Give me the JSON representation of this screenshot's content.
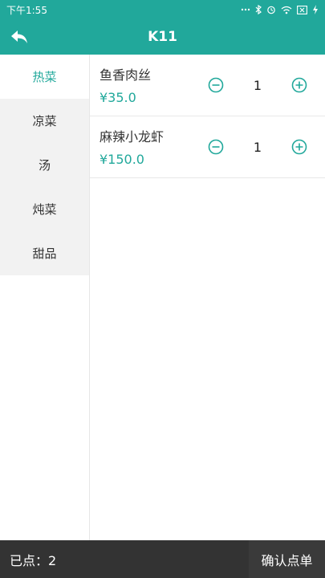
{
  "status_bar": {
    "time": "下午1:55",
    "icons": [
      "dots-icon",
      "bluetooth-icon",
      "alarm-icon",
      "wifi-icon",
      "sim-x-icon",
      "battery-charging-icon"
    ]
  },
  "header": {
    "title": "K11",
    "back_icon": "back-arrow-icon"
  },
  "sidebar": {
    "categories": [
      "热菜",
      "凉菜",
      "汤",
      "炖菜",
      "甜品"
    ],
    "active_index": 0
  },
  "dishes": [
    {
      "name": "鱼香肉丝",
      "price": "¥35.0",
      "quantity": "1"
    },
    {
      "name": "麻辣小龙虾",
      "price": "¥150.0",
      "quantity": "1"
    }
  ],
  "footer": {
    "count_label": "已点：2",
    "confirm_label": "确认点单"
  },
  "colors": {
    "accent": "#21a89b",
    "footer_bg": "#333333",
    "sidebar_bg": "#f2f2f2"
  }
}
